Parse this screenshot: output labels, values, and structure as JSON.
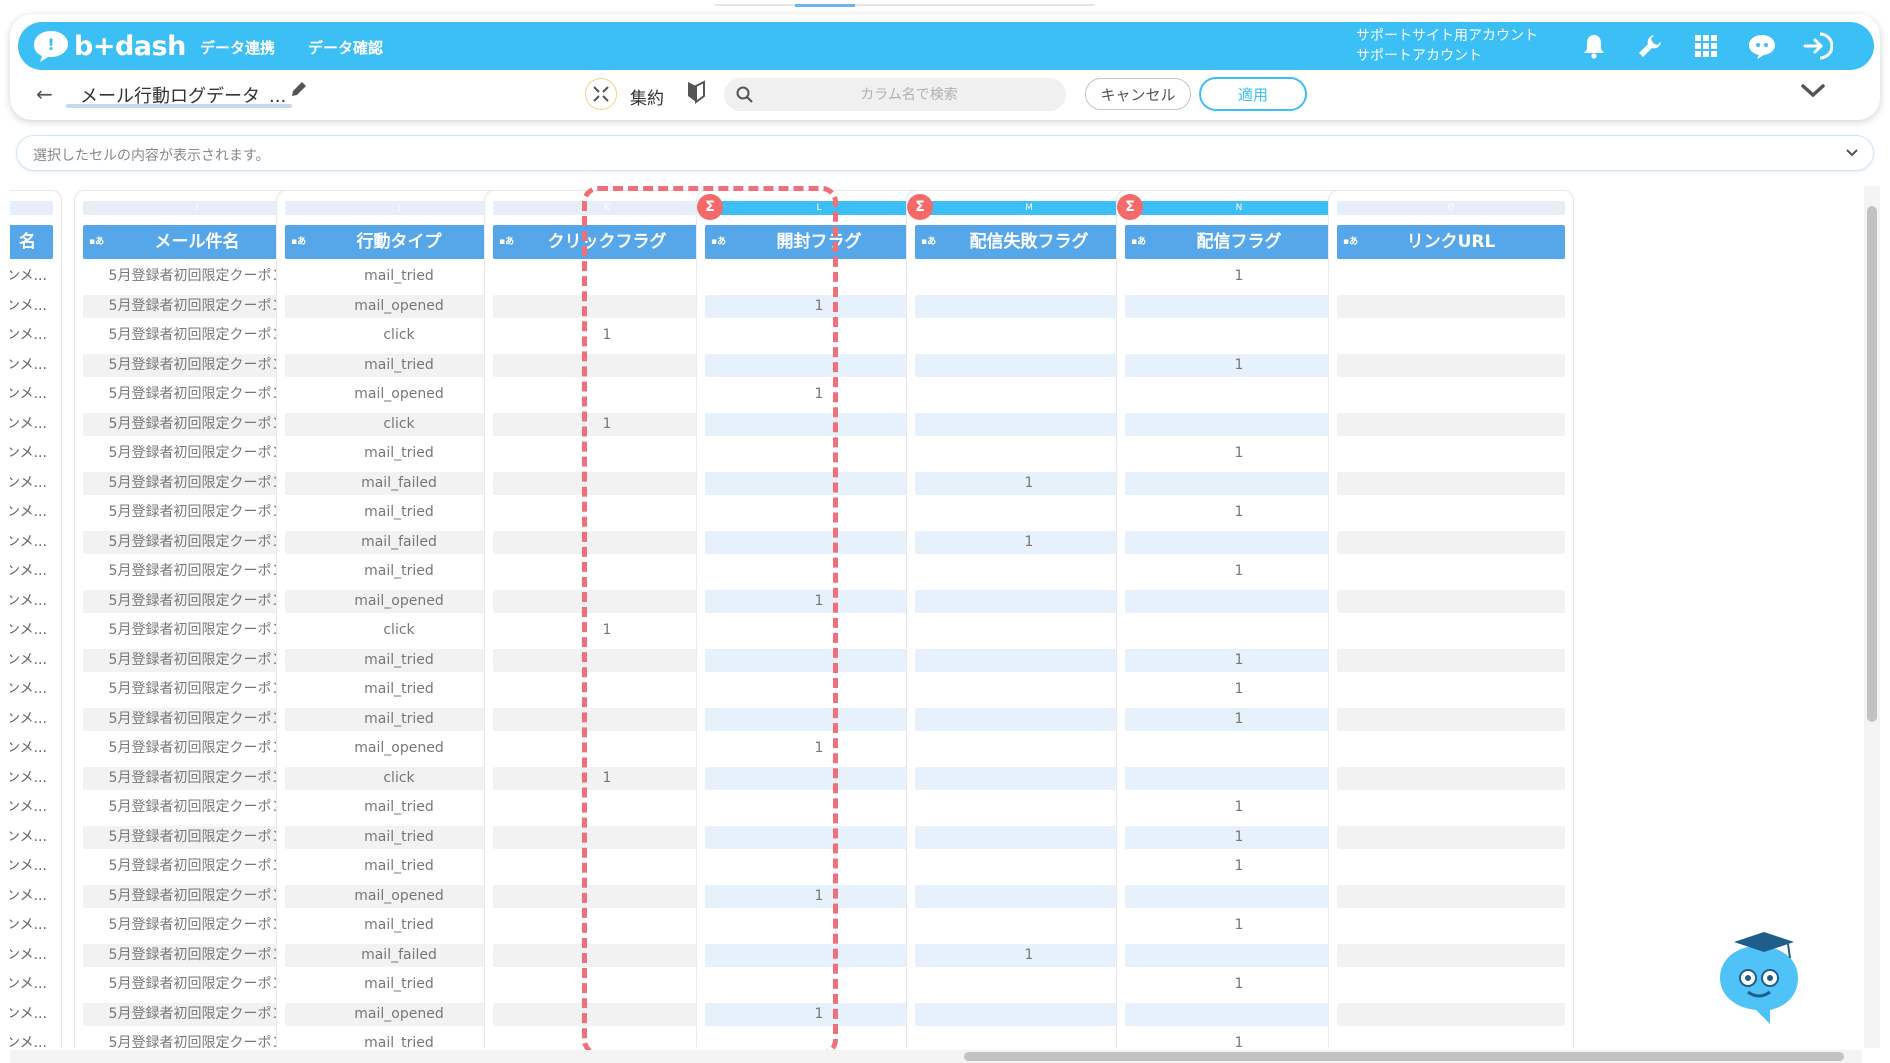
{
  "topbar": {
    "logo": "b+dash",
    "nav": [
      "データ連携",
      "データ確認"
    ],
    "account_line1": "サポートサイト用アカウント",
    "account_line2": "サポートアカウント"
  },
  "toolbar": {
    "back": "←",
    "title": "メール行動ログデータ_...",
    "aggregate_label": "集約",
    "search_placeholder": "カラム名で検索",
    "cancel_label": "キャンセル",
    "apply_label": "適用"
  },
  "cell_bar": {
    "placeholder": "選択したセルの内容が表示されます。"
  },
  "grid": {
    "partial_column": {
      "header": "名",
      "row_text": "ンメ..."
    },
    "columns": [
      {
        "letter": "I",
        "name": "メール件名",
        "type_tag": "▪あ",
        "sigma": false
      },
      {
        "letter": "J",
        "name": "行動タイプ",
        "type_tag": "▪あ",
        "sigma": false
      },
      {
        "letter": "K",
        "name": "クリックフラグ",
        "type_tag": "▪あ",
        "sigma": false
      },
      {
        "letter": "L",
        "name": "開封フラグ",
        "type_tag": "▪あ",
        "sigma": true
      },
      {
        "letter": "M",
        "name": "配信失敗フラグ",
        "type_tag": "▪あ",
        "sigma": true
      },
      {
        "letter": "N",
        "name": "配信フラグ",
        "type_tag": "▪あ",
        "sigma": true
      },
      {
        "letter": "O",
        "name": "リンクURL",
        "type_tag": "▪あ",
        "sigma": false
      }
    ],
    "subject_text": "5月登録者初回限定クーポン",
    "rows": [
      {
        "type": "mail_tried",
        "click": "",
        "open": "",
        "fail": "",
        "sent": "1"
      },
      {
        "type": "mail_opened",
        "click": "",
        "open": "1",
        "fail": "",
        "sent": ""
      },
      {
        "type": "click",
        "click": "1",
        "open": "",
        "fail": "",
        "sent": ""
      },
      {
        "type": "mail_tried",
        "click": "",
        "open": "",
        "fail": "",
        "sent": "1"
      },
      {
        "type": "mail_opened",
        "click": "",
        "open": "1",
        "fail": "",
        "sent": ""
      },
      {
        "type": "click",
        "click": "1",
        "open": "",
        "fail": "",
        "sent": ""
      },
      {
        "type": "mail_tried",
        "click": "",
        "open": "",
        "fail": "",
        "sent": "1"
      },
      {
        "type": "mail_failed",
        "click": "",
        "open": "",
        "fail": "1",
        "sent": ""
      },
      {
        "type": "mail_tried",
        "click": "",
        "open": "",
        "fail": "",
        "sent": "1"
      },
      {
        "type": "mail_failed",
        "click": "",
        "open": "",
        "fail": "1",
        "sent": ""
      },
      {
        "type": "mail_tried",
        "click": "",
        "open": "",
        "fail": "",
        "sent": "1"
      },
      {
        "type": "mail_opened",
        "click": "",
        "open": "1",
        "fail": "",
        "sent": ""
      },
      {
        "type": "click",
        "click": "1",
        "open": "",
        "fail": "",
        "sent": ""
      },
      {
        "type": "mail_tried",
        "click": "",
        "open": "",
        "fail": "",
        "sent": "1"
      },
      {
        "type": "mail_tried",
        "click": "",
        "open": "",
        "fail": "",
        "sent": "1"
      },
      {
        "type": "mail_tried",
        "click": "",
        "open": "",
        "fail": "",
        "sent": "1"
      },
      {
        "type": "mail_opened",
        "click": "",
        "open": "1",
        "fail": "",
        "sent": ""
      },
      {
        "type": "click",
        "click": "1",
        "open": "",
        "fail": "",
        "sent": ""
      },
      {
        "type": "mail_tried",
        "click": "",
        "open": "",
        "fail": "",
        "sent": "1"
      },
      {
        "type": "mail_tried",
        "click": "",
        "open": "",
        "fail": "",
        "sent": "1"
      },
      {
        "type": "mail_tried",
        "click": "",
        "open": "",
        "fail": "",
        "sent": "1"
      },
      {
        "type": "mail_opened",
        "click": "",
        "open": "1",
        "fail": "",
        "sent": ""
      },
      {
        "type": "mail_tried",
        "click": "",
        "open": "",
        "fail": "",
        "sent": "1"
      },
      {
        "type": "mail_failed",
        "click": "",
        "open": "",
        "fail": "1",
        "sent": ""
      },
      {
        "type": "mail_tried",
        "click": "",
        "open": "",
        "fail": "",
        "sent": "1"
      },
      {
        "type": "mail_opened",
        "click": "",
        "open": "1",
        "fail": "",
        "sent": ""
      },
      {
        "type": "mail_tried",
        "click": "",
        "open": "",
        "fail": "",
        "sent": "1"
      }
    ]
  },
  "colors": {
    "brand": "#3cbff4",
    "header": "#56a6ea",
    "sigma": "#f46a6a",
    "highlight": "#f0707a"
  },
  "icons": [
    "bell-icon",
    "wrench-icon",
    "grid-icon",
    "chat-icon",
    "logout-icon",
    "search-icon",
    "pencil-icon",
    "chevron-down-icon"
  ]
}
